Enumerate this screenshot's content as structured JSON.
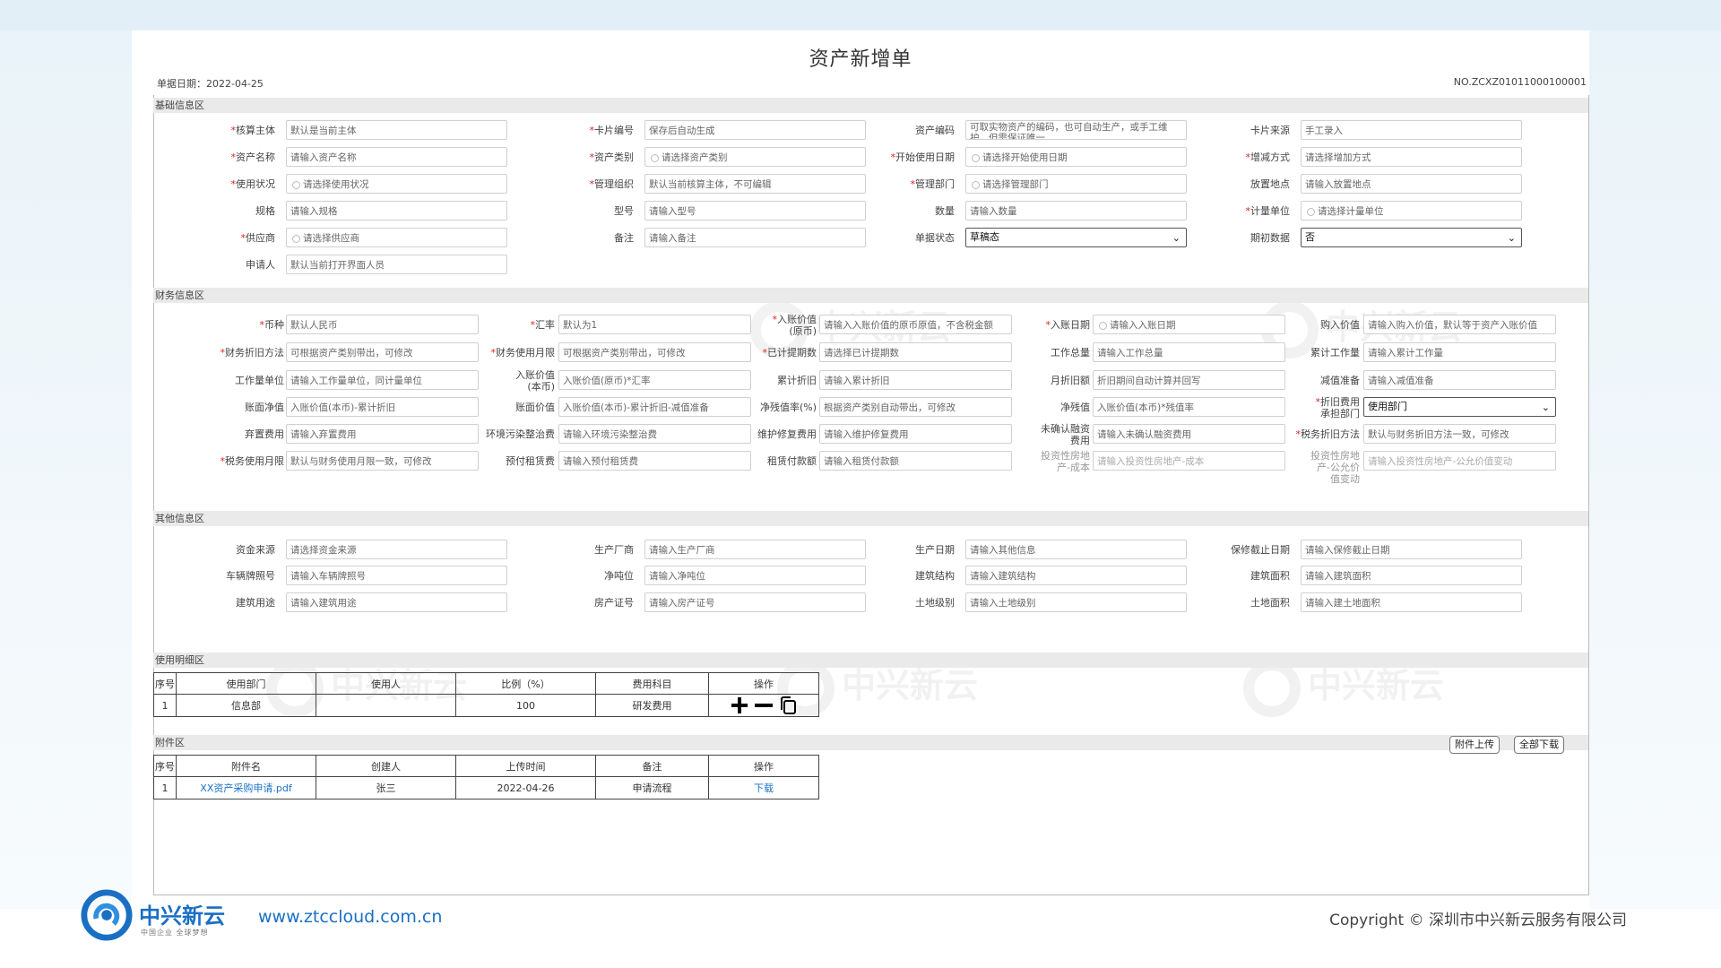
{
  "document": {
    "title": "资产新增单",
    "date_label": "单据日期：",
    "date": "2022-04-25",
    "number": "NO.ZCXZ01011000100001"
  },
  "sections": {
    "basic": "基础信息区",
    "finance": "财务信息区",
    "other": "其他信息区",
    "usage": "使用明细区",
    "attach": "附件区"
  },
  "basic_fields": [
    {
      "label": "核算主体",
      "required": true,
      "value": "默认是当前主体",
      "kind": "text"
    },
    {
      "label": "卡片编号",
      "required": true,
      "value": "保存后自动生成",
      "kind": "text"
    },
    {
      "label": "资产编码",
      "required": false,
      "value": "可取实物资产的编码，也可自动生产，或手工维护，但需保证唯一",
      "kind": "text2"
    },
    {
      "label": "卡片来源",
      "required": false,
      "value": "手工录入",
      "kind": "text"
    },
    {
      "label": "资产名称",
      "required": true,
      "value": "请输入资产名称",
      "kind": "text"
    },
    {
      "label": "资产类别",
      "required": true,
      "value": "请选择资产类别",
      "kind": "search"
    },
    {
      "label": "开始使用日期",
      "required": true,
      "value": "请选择开始使用日期",
      "kind": "search"
    },
    {
      "label": "增减方式",
      "required": true,
      "value": "请选择增加方式",
      "kind": "text"
    },
    {
      "label": "使用状况",
      "required": true,
      "value": "请选择使用状况",
      "kind": "search"
    },
    {
      "label": "管理组织",
      "required": true,
      "value": "默认当前核算主体，不可编辑",
      "kind": "text"
    },
    {
      "label": "管理部门",
      "required": true,
      "value": "请选择管理部门",
      "kind": "search"
    },
    {
      "label": "放置地点",
      "required": false,
      "value": "请输入放置地点",
      "kind": "text"
    },
    {
      "label": "规格",
      "required": false,
      "value": "请输入规格",
      "kind": "text"
    },
    {
      "label": "型号",
      "required": false,
      "value": "请输入型号",
      "kind": "text"
    },
    {
      "label": "数量",
      "required": false,
      "value": "请输入数量",
      "kind": "text"
    },
    {
      "label": "计量单位",
      "required": true,
      "value": "请选择计量单位",
      "kind": "search"
    },
    {
      "label": "供应商",
      "required": true,
      "value": "请选择供应商",
      "kind": "search"
    },
    {
      "label": "备注",
      "required": false,
      "value": "请输入备注",
      "kind": "text"
    },
    {
      "label": "单据状态",
      "required": false,
      "value": "草稿态",
      "kind": "select"
    },
    {
      "label": "期初数据",
      "required": false,
      "value": "否",
      "kind": "select"
    },
    {
      "label": "申请人",
      "required": false,
      "value": "默认当前打开界面人员",
      "kind": "text"
    }
  ],
  "finance_fields": [
    {
      "label": "币种",
      "required": true,
      "value": "默认人民币",
      "kind": "text"
    },
    {
      "label": "汇率",
      "required": true,
      "value": "默认为1",
      "kind": "text"
    },
    {
      "label": "入账价值(原币)",
      "required": true,
      "value": "请输入入账价值的原币原值，不含税金额",
      "kind": "text"
    },
    {
      "label": "入账日期",
      "required": true,
      "value": "请输入入账日期",
      "kind": "search"
    },
    {
      "label": "购入价值",
      "required": false,
      "value": "请输入购入价值，默认等于资产入账价值",
      "kind": "text"
    },
    {
      "label": "财务折旧方法",
      "required": true,
      "value": "可根据资产类别带出，可修改",
      "kind": "text"
    },
    {
      "label": "财务使用月限",
      "required": true,
      "value": "可根据资产类别带出，可修改",
      "kind": "text"
    },
    {
      "label": "已计提期数",
      "required": true,
      "value": "请选择已计提期数",
      "kind": "text"
    },
    {
      "label": "工作总量",
      "required": false,
      "value": "请输入工作总量",
      "kind": "text"
    },
    {
      "label": "累计工作量",
      "required": false,
      "value": "请输入累计工作量",
      "kind": "text"
    },
    {
      "label": "工作量单位",
      "required": false,
      "value": "请输入工作量单位，同计量单位",
      "kind": "text"
    },
    {
      "label": "入账价值(本币)",
      "required": false,
      "value": "入账价值(原币)*汇率",
      "kind": "text"
    },
    {
      "label": "累计折旧",
      "required": false,
      "value": "请输入累计折旧",
      "kind": "text"
    },
    {
      "label": "月折旧额",
      "required": false,
      "value": "折旧期间自动计算并回写",
      "kind": "text"
    },
    {
      "label": "减值准备",
      "required": false,
      "value": "请输入减值准备",
      "kind": "text"
    },
    {
      "label": "账面净值",
      "required": false,
      "value": "入账价值(本币)-累计折旧",
      "kind": "text"
    },
    {
      "label": "账面价值",
      "required": false,
      "value": "入账价值(本币)-累计折旧-减值准备",
      "kind": "text"
    },
    {
      "label": "净残值率(%)",
      "required": false,
      "value": "根据资产类别自动带出，可修改",
      "kind": "text"
    },
    {
      "label": "净残值",
      "required": false,
      "value": "入账价值(本币)*残值率",
      "kind": "text"
    },
    {
      "label": "折旧费用承担部门",
      "required": true,
      "value": "使用部门",
      "kind": "select"
    },
    {
      "label": "弃置费用",
      "required": false,
      "value": "请输入弃置费用",
      "kind": "text"
    },
    {
      "label": "环境污染整治费",
      "required": false,
      "value": "请输入环境污染整治费",
      "kind": "text"
    },
    {
      "label": "维护修复费用",
      "required": false,
      "value": "请输入维护修复费用",
      "kind": "text"
    },
    {
      "label": "未确认融资费用",
      "required": false,
      "value": "请输入未确认融资费用",
      "kind": "text"
    },
    {
      "label": "税务折旧方法",
      "required": true,
      "value": "默认与财务折旧方法一致，可修改",
      "kind": "text"
    },
    {
      "label": "税务使用月限",
      "required": true,
      "value": "默认与财务使用月限一致，可修改",
      "kind": "text"
    },
    {
      "label": "预付租赁费",
      "required": false,
      "value": "请输入预付租赁费",
      "kind": "text"
    },
    {
      "label": "租赁付款额",
      "required": false,
      "value": "请输入租赁付款额",
      "kind": "text"
    },
    {
      "label": "投资性房地产-成本",
      "required": false,
      "value": "请输入投资性房地产-成本",
      "kind": "text",
      "disabled": true
    },
    {
      "label": "投资性房地产-公允价值变动",
      "required": false,
      "value": "请输入投资性房地产-公允价值变动",
      "kind": "text",
      "disabled": true
    }
  ],
  "other_fields": [
    {
      "label": "资金来源",
      "value": "请选择资金来源"
    },
    {
      "label": "生产厂商",
      "value": "请输入生产厂商"
    },
    {
      "label": "生产日期",
      "value": "请输入其他信息"
    },
    {
      "label": "保修截止日期",
      "value": "请输入保修截止日期"
    },
    {
      "label": "车辆牌照号",
      "value": "请输入车辆牌照号"
    },
    {
      "label": "净吨位",
      "value": "请输入净吨位"
    },
    {
      "label": "建筑结构",
      "value": "请输入建筑结构"
    },
    {
      "label": "建筑面积",
      "value": "请输入建筑面积"
    },
    {
      "label": "建筑用途",
      "value": "请输入建筑用途"
    },
    {
      "label": "房产证号",
      "value": "请输入房产证号"
    },
    {
      "label": "土地级别",
      "value": "请输入土地级别"
    },
    {
      "label": "土地面积",
      "value": "请输入建土地面积"
    }
  ],
  "usage_table": {
    "headers": [
      "序号",
      "使用部门",
      "使用人",
      "比例（%）",
      "费用科目",
      "操作"
    ],
    "rows": [
      {
        "seq": "1",
        "dept": "信息部",
        "user": "",
        "ratio": "100",
        "subject": "研发费用"
      }
    ]
  },
  "attach_table": {
    "headers": [
      "序号",
      "附件名",
      "创建人",
      "上传时间",
      "备注",
      "操作"
    ],
    "rows": [
      {
        "seq": "1",
        "name": "XX资产采购申请.pdf",
        "creator": "张三",
        "time": "2022-04-26",
        "note": "申请流程",
        "op": "下载"
      }
    ],
    "upload_label": "附件上传",
    "download_all_label": "全部下载"
  },
  "watermark": "中兴新云",
  "footer": {
    "brand": "中兴新云",
    "slogan": "中国企业 全球梦想",
    "url": "www.ztccloud.com.cn",
    "copyright": "Copyright © 深圳市中兴新云服务有限公司"
  },
  "colors": {
    "accent": "#1a6fc4",
    "required": "#e02020",
    "link": "#1a73c8"
  }
}
